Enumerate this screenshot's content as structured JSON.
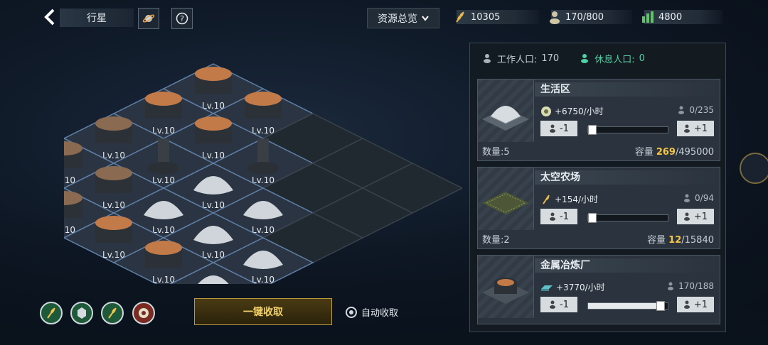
{
  "header": {
    "title": "行星",
    "resource_dropdown": "资源总览"
  },
  "resources": [
    {
      "icon": "wheat-icon",
      "value": "10305"
    },
    {
      "icon": "population-icon",
      "value": "170/800"
    },
    {
      "icon": "metal-bars-icon",
      "value": "4800"
    }
  ],
  "population": {
    "working_label": "工作人口:",
    "working_value": "170",
    "resting_label": "休息人口:",
    "resting_value": "0"
  },
  "buildings": [
    {
      "name": "生活区",
      "rate": "+6750/小时",
      "workers": "0/235",
      "minus": "-1",
      "plus": "+1",
      "count": "数量:5",
      "capacity_label": "容量",
      "capacity_current": "269",
      "capacity_max": "/495000",
      "slider": 0.0
    },
    {
      "name": "太空农场",
      "rate": "+154/小时",
      "workers": "0/94",
      "minus": "-1",
      "plus": "+1",
      "count": "数量:2",
      "capacity_label": "容量",
      "capacity_current": "12",
      "capacity_max": "/15840",
      "slider": 0.0
    },
    {
      "name": "金属冶炼厂",
      "rate": "+3770/小时",
      "workers": "170/188",
      "minus": "-1",
      "plus": "+1",
      "slider": 0.9
    }
  ],
  "tiles": [
    "Lv.10",
    "Lv.10",
    "Lv.10",
    "Lv.10",
    "Lv.10",
    "Lv.10",
    "Lv.10",
    "Lv.10",
    "Lv.10",
    "Lv.10",
    "Lv.10",
    "Lv.10",
    "Lv.10",
    "Lv.10",
    "Lv.10",
    "Lv.10",
    "Lv.10",
    "Lv.10",
    "Lv.10",
    "Lv.10",
    "Lv.10"
  ],
  "bottom": {
    "collect_all": "一键收取",
    "auto_collect": "自动收取"
  },
  "colors": {
    "accent_gold": "#f2c447",
    "resting_green": "#4fd1a5"
  }
}
